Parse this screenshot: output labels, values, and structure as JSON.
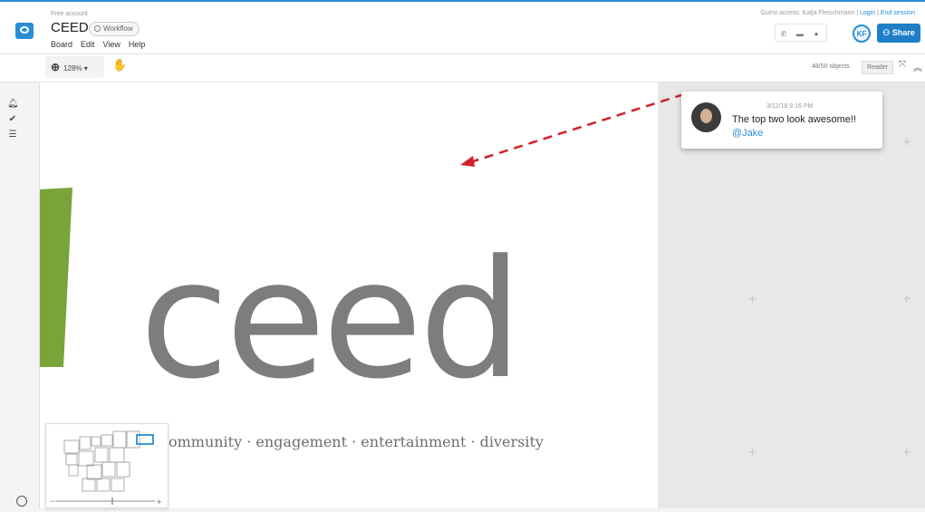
{
  "app": {
    "account": "Free account",
    "board_title": "CEED",
    "workflow_label": "Workflow",
    "menu": [
      "Board",
      "Edit",
      "View",
      "Help"
    ]
  },
  "session": {
    "guest_prefix": "Guest access: Katja Fleischmann |",
    "login": "Login",
    "separator": "|",
    "end_session": "End session",
    "avatar_initials": "KF",
    "share_label": "Share"
  },
  "toolbar": {
    "zoom": "128%",
    "objects": "48/50 objects",
    "reader": "Reader"
  },
  "canvas": {
    "logo_word": "ceed",
    "tagline": "community · engagement · entertainment · diversity"
  },
  "comment": {
    "time": "3/12/18 9:16 PM",
    "text": "The top two look awesome!!",
    "mention": "@Jake"
  },
  "colors": {
    "accent": "#2a8dd4",
    "arrow": "#d0202a",
    "logo_green": "#7aa33a"
  }
}
